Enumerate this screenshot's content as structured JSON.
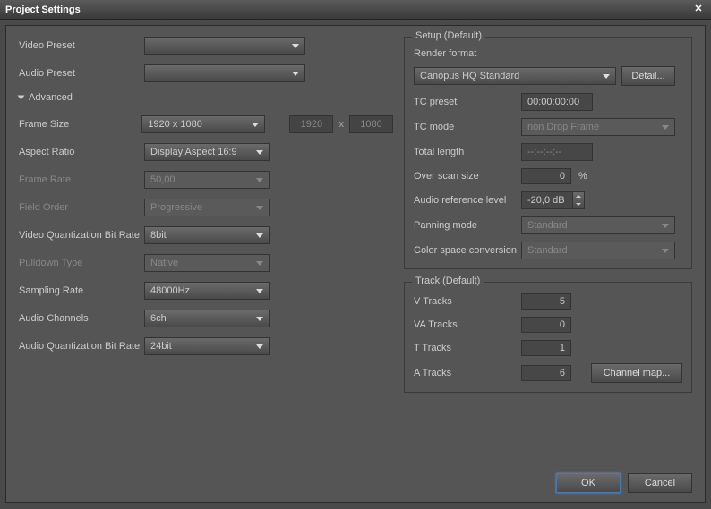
{
  "title": "Project Settings",
  "left": {
    "video_preset_label": "Video Preset",
    "video_preset_value": "",
    "audio_preset_label": "Audio Preset",
    "audio_preset_value": "",
    "advanced_label": "Advanced",
    "frame_size_label": "Frame Size",
    "frame_size_value": "1920 x 1080",
    "frame_w": "1920",
    "frame_x": "x",
    "frame_h": "1080",
    "aspect_label": "Aspect Ratio",
    "aspect_value": "Display Aspect 16:9",
    "frame_rate_label": "Frame Rate",
    "frame_rate_value": "50,00",
    "field_order_label": "Field Order",
    "field_order_value": "Progressive",
    "vqbr_label": "Video Quantization Bit Rate",
    "vqbr_value": "8bit",
    "pulldown_label": "Pulldown Type",
    "pulldown_value": "Native",
    "sampling_label": "Sampling Rate",
    "sampling_value": "48000Hz",
    "channels_label": "Audio Channels",
    "channels_value": "6ch",
    "aqbr_label": "Audio Quantization Bit Rate",
    "aqbr_value": "24bit"
  },
  "setup": {
    "legend": "Setup (Default)",
    "render_label": "Render format",
    "render_value": "Canopus HQ Standard",
    "detail_btn": "Detail...",
    "tc_preset_label": "TC preset",
    "tc_preset_value": "00:00:00:00",
    "tc_mode_label": "TC mode",
    "tc_mode_value": "non Drop Frame",
    "total_length_label": "Total length",
    "total_length_value": "--:--:--:--",
    "overscan_label": "Over scan size",
    "overscan_value": "0",
    "overscan_unit": "%",
    "audio_ref_label": "Audio reference level",
    "audio_ref_value": "-20,0 dB",
    "panning_label": "Panning mode",
    "panning_value": "Standard",
    "color_label": "Color space conversion",
    "color_value": "Standard"
  },
  "track": {
    "legend": "Track (Default)",
    "v_label": "V Tracks",
    "v_value": "5",
    "va_label": "VA Tracks",
    "va_value": "0",
    "t_label": "T Tracks",
    "t_value": "1",
    "a_label": "A Tracks",
    "a_value": "6",
    "channel_map_btn": "Channel map..."
  },
  "buttons": {
    "ok": "OK",
    "cancel": "Cancel"
  }
}
